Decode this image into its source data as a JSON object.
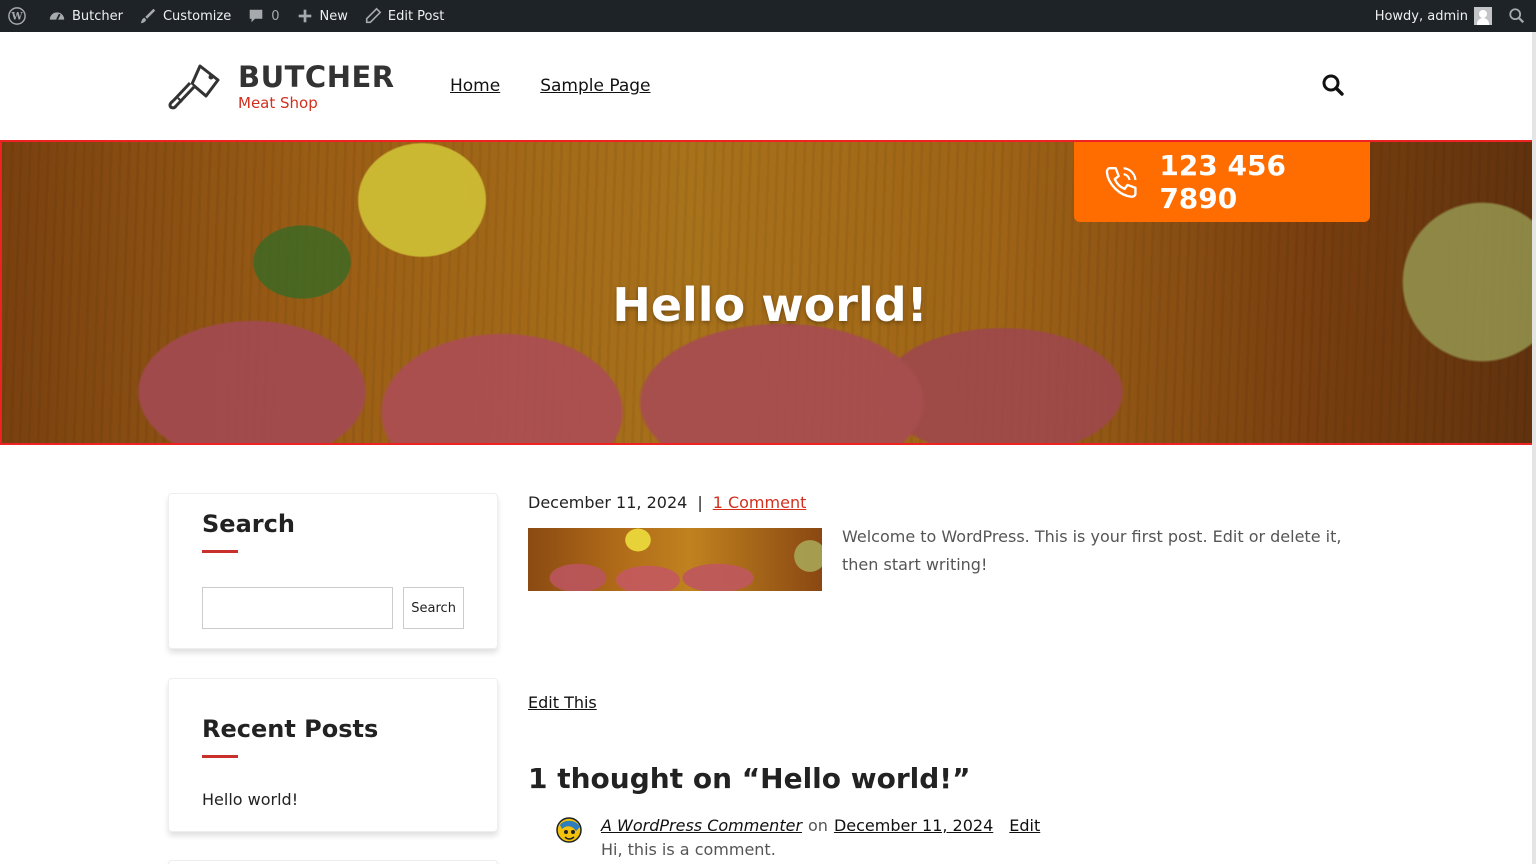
{
  "admin_bar": {
    "site_name": "Butcher",
    "customize_label": "Customize",
    "comments_count": "0",
    "new_label": "New",
    "edit_post_label": "Edit Post",
    "greeting": "Howdy, admin",
    "icons": [
      "wordpress-logo-icon",
      "dashboard-icon",
      "brush-icon",
      "comment-bubble-icon",
      "plus-icon",
      "pencil-icon",
      "user-avatar-icon",
      "search-icon"
    ]
  },
  "header": {
    "logo_title": "BUTCHER",
    "logo_tagline": "Meat Shop",
    "nav": [
      {
        "label": "Home"
      },
      {
        "label": "Sample Page"
      }
    ]
  },
  "hero": {
    "title": "Hello world!",
    "phone": "123 456 7890"
  },
  "sidebar": {
    "search_widget": {
      "title": "Search",
      "button_label": "Search",
      "input_value": ""
    },
    "recent_posts_widget": {
      "title": "Recent Posts",
      "items": [
        {
          "label": "Hello world!"
        }
      ]
    }
  },
  "post": {
    "date": "December 11, 2024",
    "separator": "|",
    "comments_link": "1 Comment",
    "excerpt": "Welcome to WordPress. This is your first post. Edit or delete it, then start writing!",
    "edit_link": "Edit This"
  },
  "comments": {
    "title": "1 thought on “Hello world!”",
    "items": [
      {
        "author": "A WordPress Commenter",
        "on": "on",
        "date": "December 11, 2024",
        "edit": "Edit",
        "text": "Hi, this is a comment."
      }
    ]
  },
  "colors": {
    "accent": "#d1301f",
    "phone_box": "#ff6c00",
    "admin_bar": "#1d2327"
  }
}
